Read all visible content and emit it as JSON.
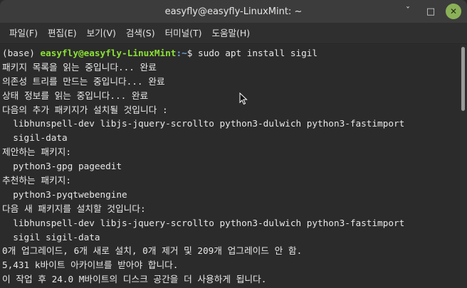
{
  "window": {
    "title": "easyfly@easyfly-LinuxMint: ~",
    "minimize_glyph": "ˇ",
    "maximize_glyph": "□",
    "close_glyph": "✕"
  },
  "menu": [
    {
      "label": "파일(F)"
    },
    {
      "label": "편집(E)"
    },
    {
      "label": "보기(V)"
    },
    {
      "label": "검색(S)"
    },
    {
      "label": "터미널(T)"
    },
    {
      "label": "도움말(H)"
    }
  ],
  "prompt": {
    "env": "(base) ",
    "user_host": "easyfly@easyfly-LinuxMint",
    "path": ":~",
    "symbol": "$ ",
    "command": "sudo apt install sigil"
  },
  "output": [
    "패키지 목록을 읽는 중입니다... 완료",
    "의존성 트리를 만드는 중입니다... 완료",
    "상태 정보를 읽는 중입니다... 완료",
    "다음의 추가 패키지가 설치될 것입니다 :",
    "  libhunspell-dev libjs-jquery-scrollto python3-dulwich python3-fastimport",
    "  sigil-data",
    "제안하는 패키지:",
    "  python3-gpg pageedit",
    "추천하는 패키지:",
    "  python3-pyqtwebengine",
    "다음 새 패키지를 설치할 것입니다:",
    "  libhunspell-dev libjs-jquery-scrollto python3-dulwich python3-fastimport",
    "  sigil sigil-data",
    "0개 업그레이드, 6개 새로 설치, 0개 제거 및 209개 업그레이드 안 함.",
    "5,431 k바이트 아카이브를 받아야 합니다.",
    "이 작업 후 24.0 M바이트의 디스크 공간을 더 사용하게 됩니다."
  ]
}
